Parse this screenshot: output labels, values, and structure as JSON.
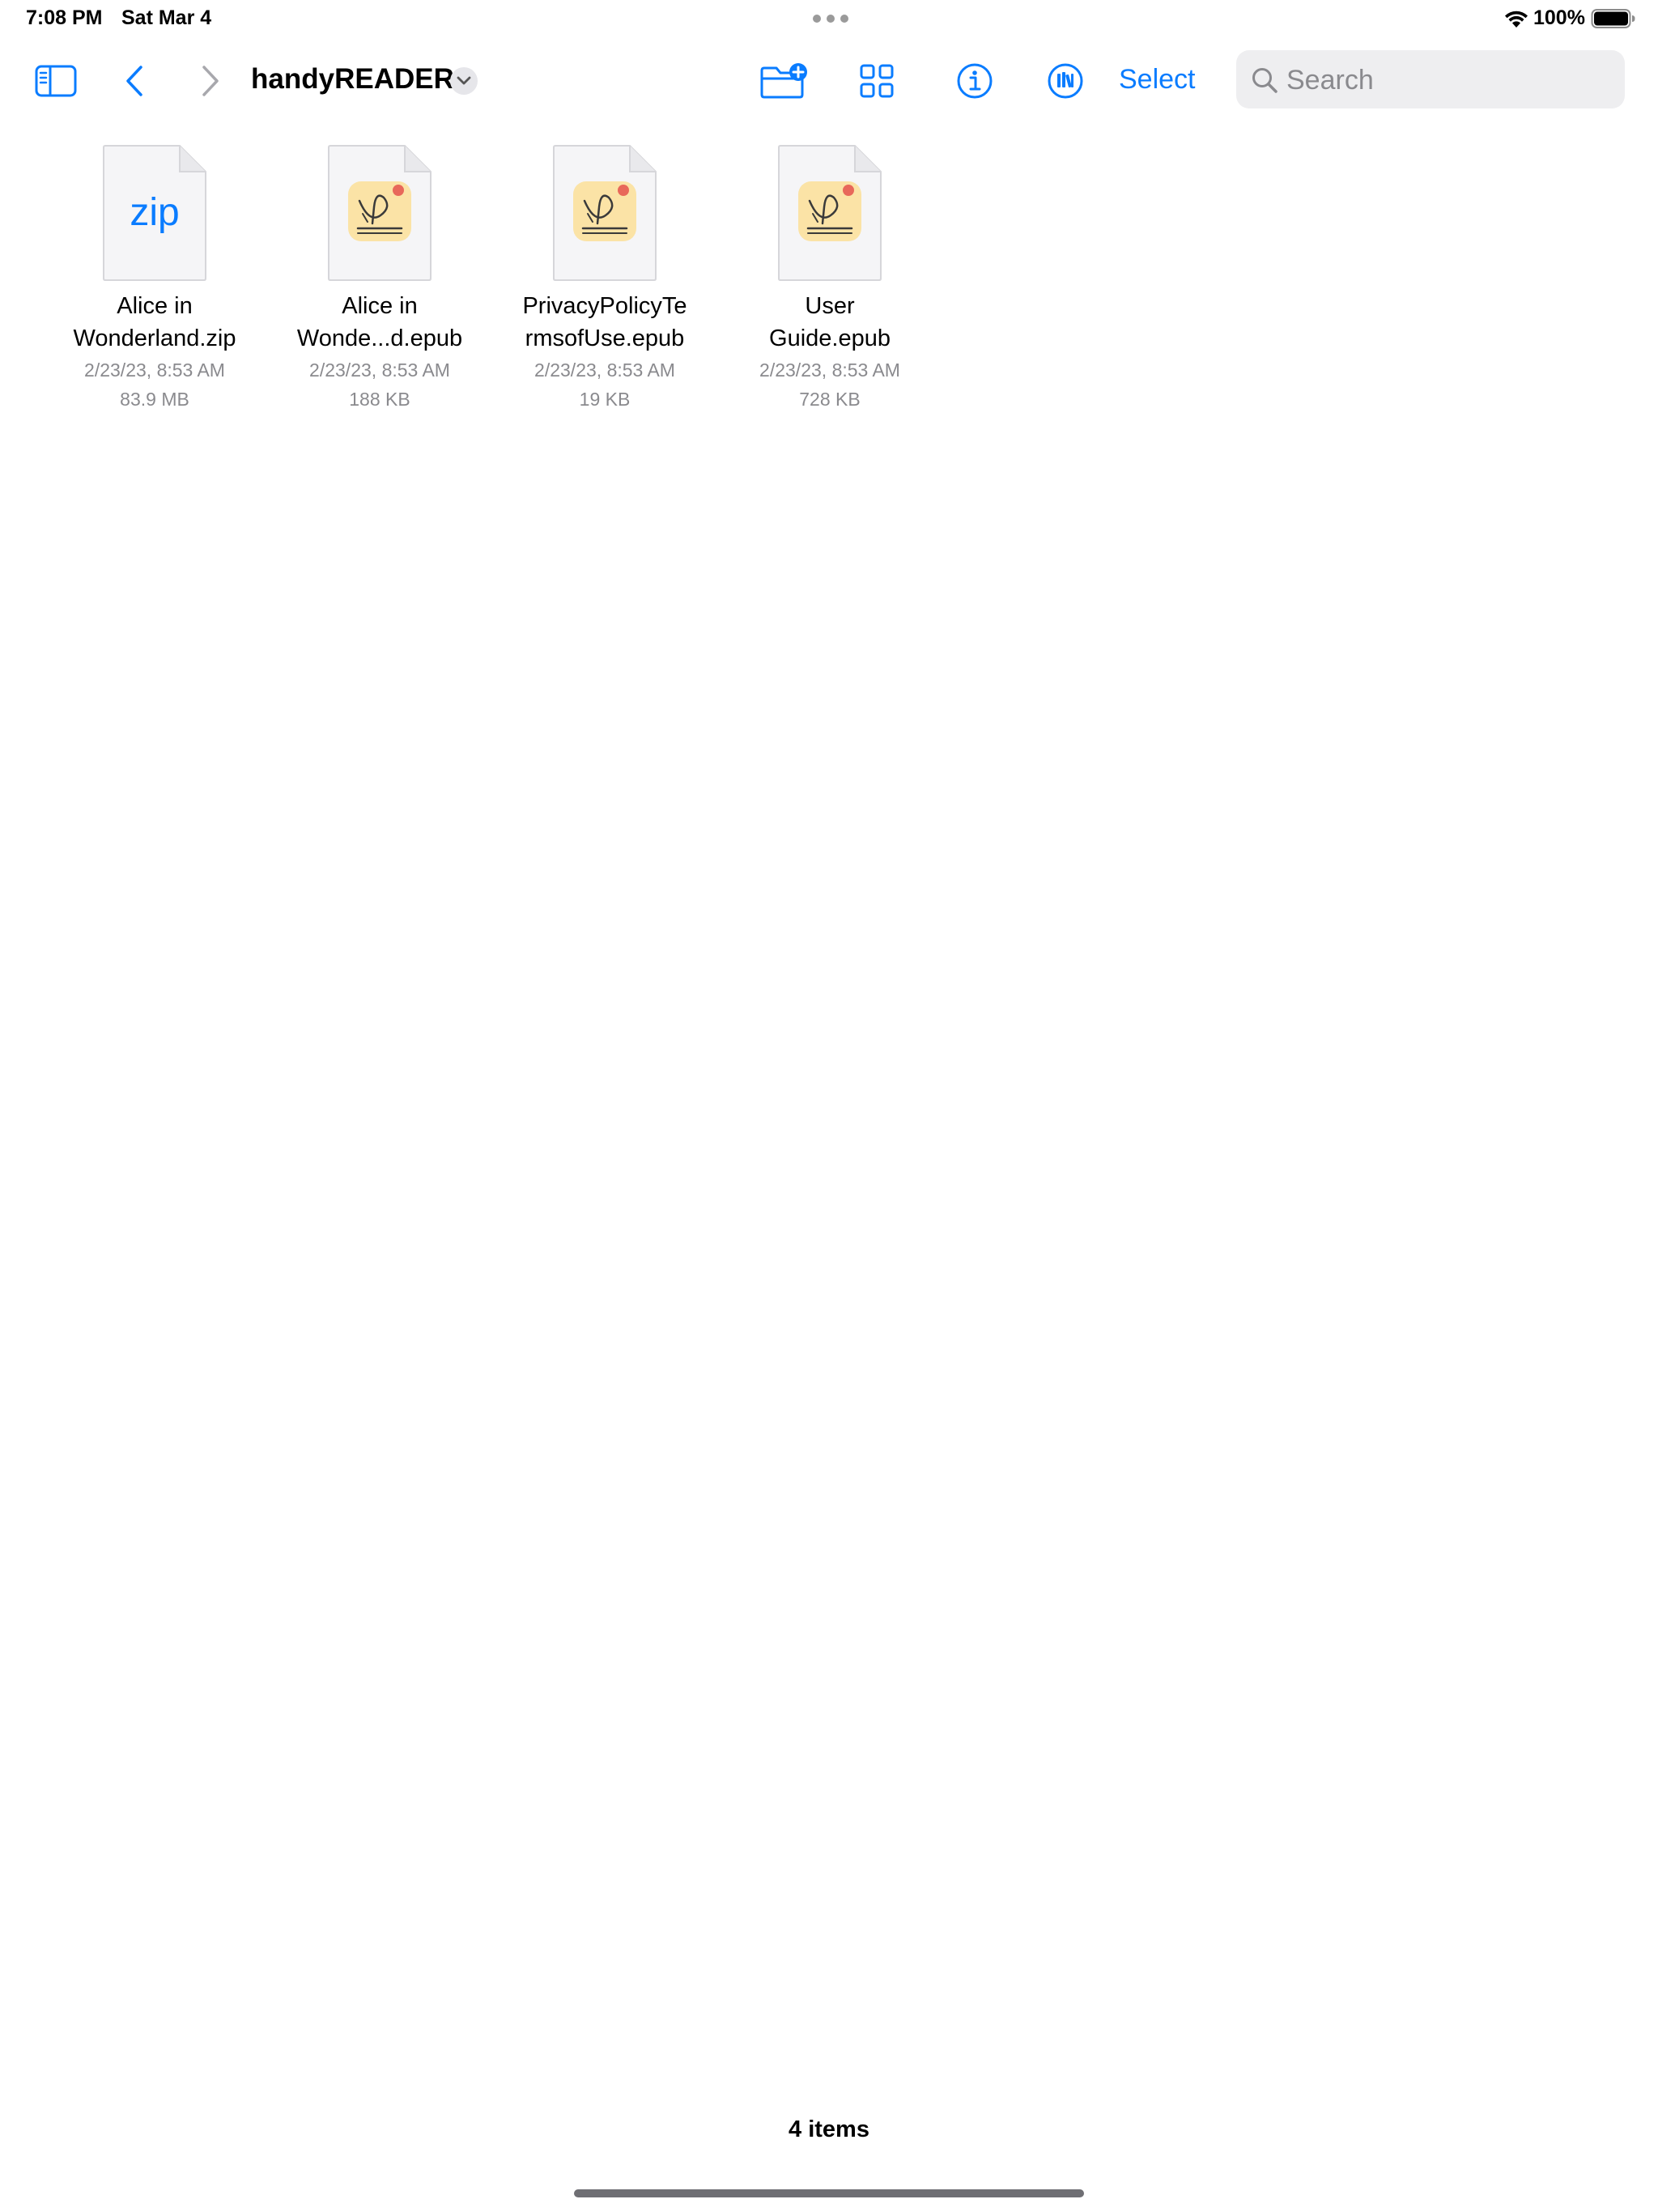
{
  "status_bar": {
    "time": "7:08 PM",
    "date": "Sat Mar 4",
    "battery_percent": "100%",
    "battery_level": 1.0,
    "icons": [
      "multitask-dots-icon",
      "wifi-icon",
      "battery-icon"
    ]
  },
  "toolbar": {
    "folder_title": "handyREADER",
    "select_label": "Select",
    "search_placeholder": "Search",
    "search_value": "",
    "icons": [
      "sidebar-icon",
      "chevron-left-icon",
      "chevron-right-icon",
      "chevron-down-icon",
      "new-folder-icon",
      "grid-view-icon",
      "info-icon",
      "library-icon",
      "search-icon"
    ]
  },
  "files": [
    {
      "name_line1": "Alice in",
      "name_line2": "Wonderland.zip",
      "date": "2/23/23, 8:53 AM",
      "size": "83.9 MB",
      "thumb_label": "zip",
      "kind": "zip"
    },
    {
      "name_line1": "Alice in",
      "name_line2": "Wonde...d.epub",
      "date": "2/23/23, 8:53 AM",
      "size": "188 KB",
      "kind": "epub"
    },
    {
      "name_line1": "PrivacyPolicyTe",
      "name_line2": "rmsofUse.epub",
      "date": "2/23/23, 8:53 AM",
      "size": "19 KB",
      "kind": "epub"
    },
    {
      "name_line1": "User",
      "name_line2": "Guide.epub",
      "date": "2/23/23, 8:53 AM",
      "size": "728 KB",
      "kind": "epub"
    }
  ],
  "footer": {
    "item_count": "4 items"
  },
  "colors": {
    "accent": "#0a7cff",
    "secondary_text": "#8a8a8e",
    "search_bg": "#eeeef0",
    "epub_icon_bg": "#fbe3a6",
    "epub_icon_dot": "#e8685a"
  }
}
